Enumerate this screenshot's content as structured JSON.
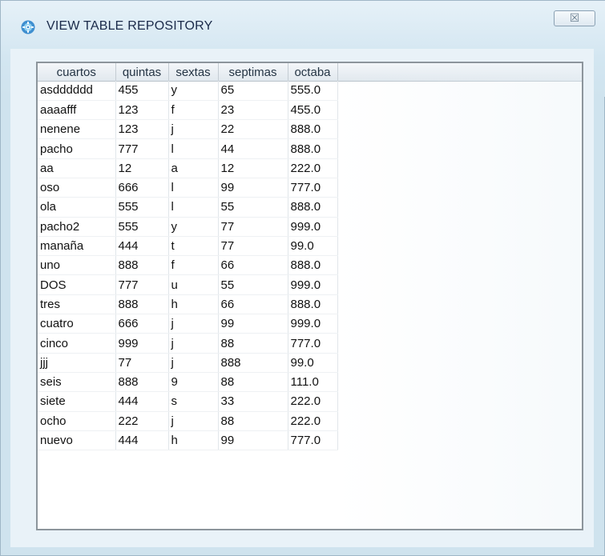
{
  "window": {
    "title": "VIEW TABLE REPOSITORY",
    "close_glyph": "☒",
    "icon": "app-gear-icon"
  },
  "table": {
    "columns": [
      "cuartos",
      "quintas",
      "sextas",
      "septimas",
      "octaba"
    ],
    "rows": [
      [
        "asdddddd",
        "455",
        "y",
        "65",
        "555.0"
      ],
      [
        "aaaafff",
        "123",
        "f",
        "23",
        "455.0"
      ],
      [
        "nenene",
        "123",
        "j",
        "22",
        "888.0"
      ],
      [
        "pacho",
        "777",
        "l",
        "44",
        "888.0"
      ],
      [
        "aa",
        "12",
        "a",
        "12",
        "222.0"
      ],
      [
        "oso",
        "666",
        "l",
        "99",
        "777.0"
      ],
      [
        "ola",
        "555",
        "l",
        "55",
        "888.0"
      ],
      [
        "pacho2",
        "555",
        "y",
        "77",
        "999.0"
      ],
      [
        "manaña",
        "444",
        "t",
        "77",
        "99.0"
      ],
      [
        "uno",
        "888",
        "f",
        "66",
        "888.0"
      ],
      [
        "DOS",
        "777",
        "u",
        "55",
        "999.0"
      ],
      [
        "tres",
        "888",
        "h",
        "66",
        "888.0"
      ],
      [
        "cuatro",
        "666",
        "j",
        "99",
        "999.0"
      ],
      [
        "cinco",
        "999",
        "j",
        "88",
        "777.0"
      ],
      [
        "jjj",
        "77",
        "j",
        "888",
        "99.0"
      ],
      [
        "seis",
        "888",
        "9",
        "88",
        "111.0"
      ],
      [
        "siete",
        "444",
        "s",
        "33",
        "222.0"
      ],
      [
        "ocho",
        "222",
        "j",
        "88",
        "222.0"
      ],
      [
        "nuevo",
        "444",
        "h",
        "99",
        "777.0"
      ]
    ]
  },
  "colors": {
    "window_bg": "#cfe3ee",
    "title_text": "#1a2a4a",
    "cell_text": "#111111"
  }
}
